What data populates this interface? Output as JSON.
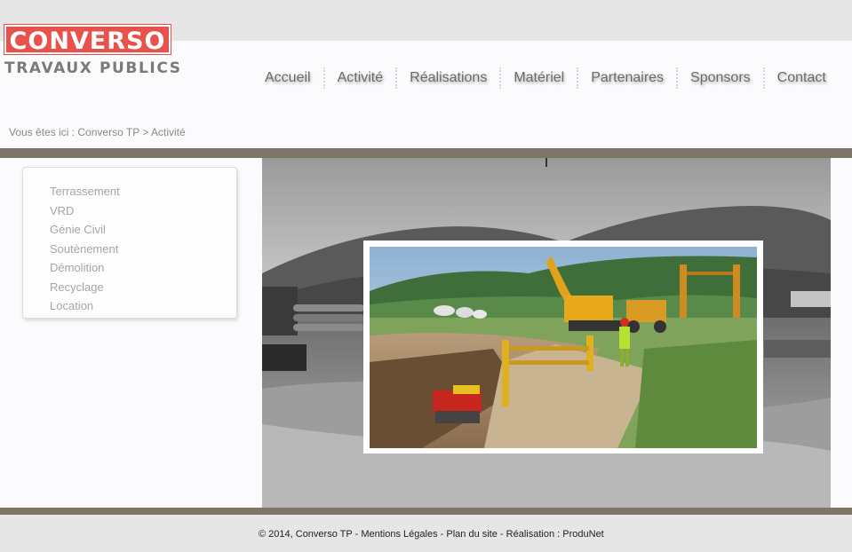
{
  "logo": {
    "name": "CONVERSO",
    "tagline": "TRAVAUX PUBLICS"
  },
  "nav": {
    "items": [
      {
        "label": "Accueil"
      },
      {
        "label": "Activité"
      },
      {
        "label": "Réalisations"
      },
      {
        "label": "Matériel"
      },
      {
        "label": "Partenaires"
      },
      {
        "label": "Sponsors"
      },
      {
        "label": "Contact"
      }
    ]
  },
  "breadcrumb": {
    "prefix": "Vous êtes ici :",
    "home": "Converso TP",
    "sep": ">",
    "current": "Activité"
  },
  "sidebar": {
    "items": [
      {
        "label": "Terrassement"
      },
      {
        "label": "VRD"
      },
      {
        "label": "Génie Civil"
      },
      {
        "label": "Soutènement"
      },
      {
        "label": "Démolition"
      },
      {
        "label": "Recyclage"
      },
      {
        "label": "Location"
      }
    ]
  },
  "footer": {
    "copyright": "© 2014, Converso TP",
    "sep": "-",
    "legal": "Mentions Légales",
    "sitemap": "Plan du site",
    "credit_prefix": "Réalisation :",
    "credit": "ProduNet"
  },
  "colors": {
    "brand_red": "#e9514b",
    "bar_brown": "#7f7567",
    "nav_text": "#6b6b6b"
  }
}
